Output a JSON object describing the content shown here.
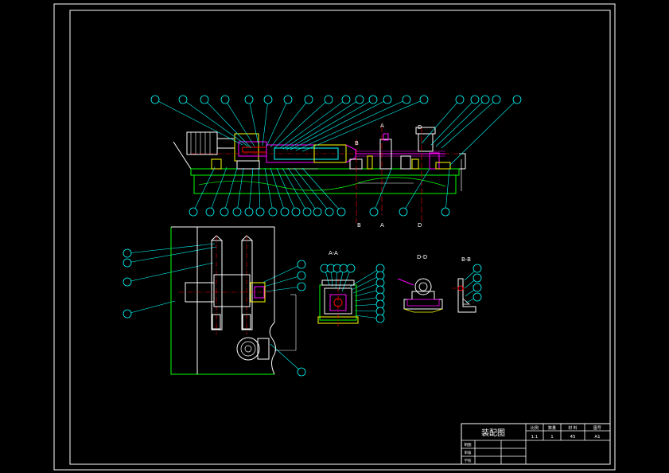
{
  "section_labels": {
    "a": "A-A",
    "d": "D-D",
    "b": "B-B"
  },
  "cut_markers": {
    "a_top": "A",
    "a_bottom": "A",
    "b_top": "B",
    "b_bottom": "B",
    "d_top": "D",
    "d_bottom": "D"
  },
  "title_block": {
    "drawing_title": "装配图",
    "headers": [
      "比例",
      "数量",
      "材 料",
      "图号"
    ],
    "values": [
      "1:1",
      "1",
      "45",
      "A1"
    ],
    "rows": [
      "制图",
      "审核",
      "学校"
    ]
  },
  "colors": {
    "background": "#000000",
    "border": "#ffffff",
    "leader": "#00ffff",
    "outline": "#00ff00",
    "part_red": "#ff0000",
    "part_magenta": "#ff00ff",
    "part_yellow": "#ffff00",
    "body_white": "#ffffff"
  }
}
